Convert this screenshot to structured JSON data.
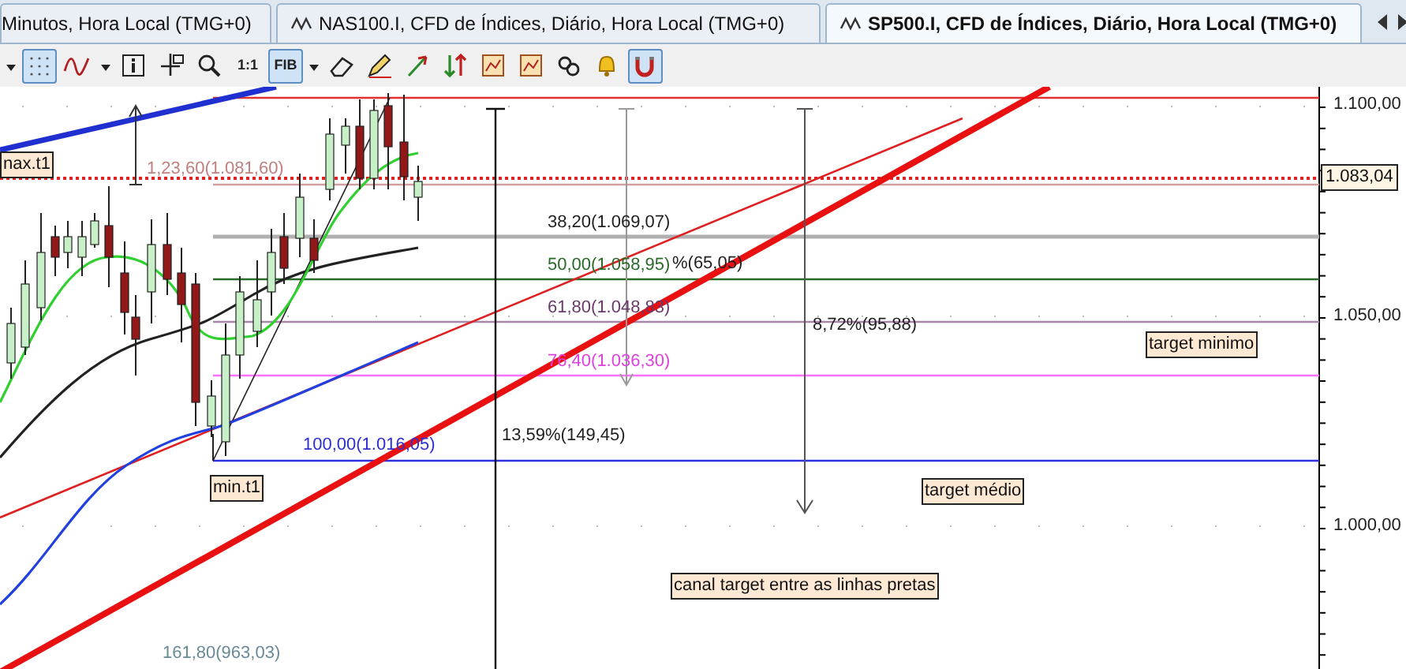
{
  "tabs": [
    {
      "label": "Minutos, Hora Local (TMG+0)",
      "selected": false
    },
    {
      "label": "NAS100.I, CFD de Índices, Diário, Hora Local (TMG+0)",
      "selected": false
    },
    {
      "label": "SP500.I, CFD de Índices, Diário, Hora Local (TMG+0)",
      "selected": true
    }
  ],
  "toolbar": [
    {
      "kind": "caret",
      "selected": false
    },
    {
      "kind": "grid",
      "selected": true
    },
    {
      "kind": "indicator",
      "selected": false
    },
    {
      "kind": "caret",
      "selected": false
    },
    {
      "kind": "info",
      "selected": false
    },
    {
      "kind": "crosshair",
      "selected": false
    },
    {
      "kind": "zoom",
      "selected": false
    },
    {
      "kind": "text",
      "label": "1:1",
      "selected": false
    },
    {
      "kind": "text",
      "label": "FIB",
      "selected": true
    },
    {
      "kind": "caret",
      "selected": false
    },
    {
      "kind": "eraser",
      "selected": false
    },
    {
      "kind": "pencil",
      "selected": false
    },
    {
      "kind": "arrow",
      "selected": false
    },
    {
      "kind": "sort",
      "selected": false
    },
    {
      "kind": "template",
      "selected": false
    },
    {
      "kind": "template",
      "selected": false
    },
    {
      "kind": "link",
      "selected": false
    },
    {
      "kind": "bell",
      "selected": false
    },
    {
      "kind": "magnet",
      "selected": true
    }
  ],
  "chart": {
    "price_axis": [
      "1.100,00",
      "1.050,00",
      "1.000,00"
    ],
    "current_price": "1.083,04",
    "fib_levels": [
      {
        "label": "1,23,60(1.081,60)",
        "color": "#c08080"
      },
      {
        "label": "38,20(1.069,07)",
        "color": "#222222"
      },
      {
        "label": "50,00(1.058,95)",
        "color": "#2a6a2a"
      },
      {
        "label": "61,80(1.048,83)",
        "color": "#6a3a6a"
      },
      {
        "label": "76,40(1.036,30)",
        "color": "#e040e0"
      },
      {
        "label": "100,00(1.016,05)",
        "color": "#3030d0"
      },
      {
        "label": "161,80(963,03)",
        "color": "#6a8a98"
      }
    ],
    "measurements": [
      "%(65,05)",
      "8,72%(95,88)",
      "13,59%(149,45)"
    ],
    "notes": [
      "nax.t1",
      "min.t1",
      "target minimo",
      "target médio",
      "canal target entre as linhas pretas"
    ]
  }
}
